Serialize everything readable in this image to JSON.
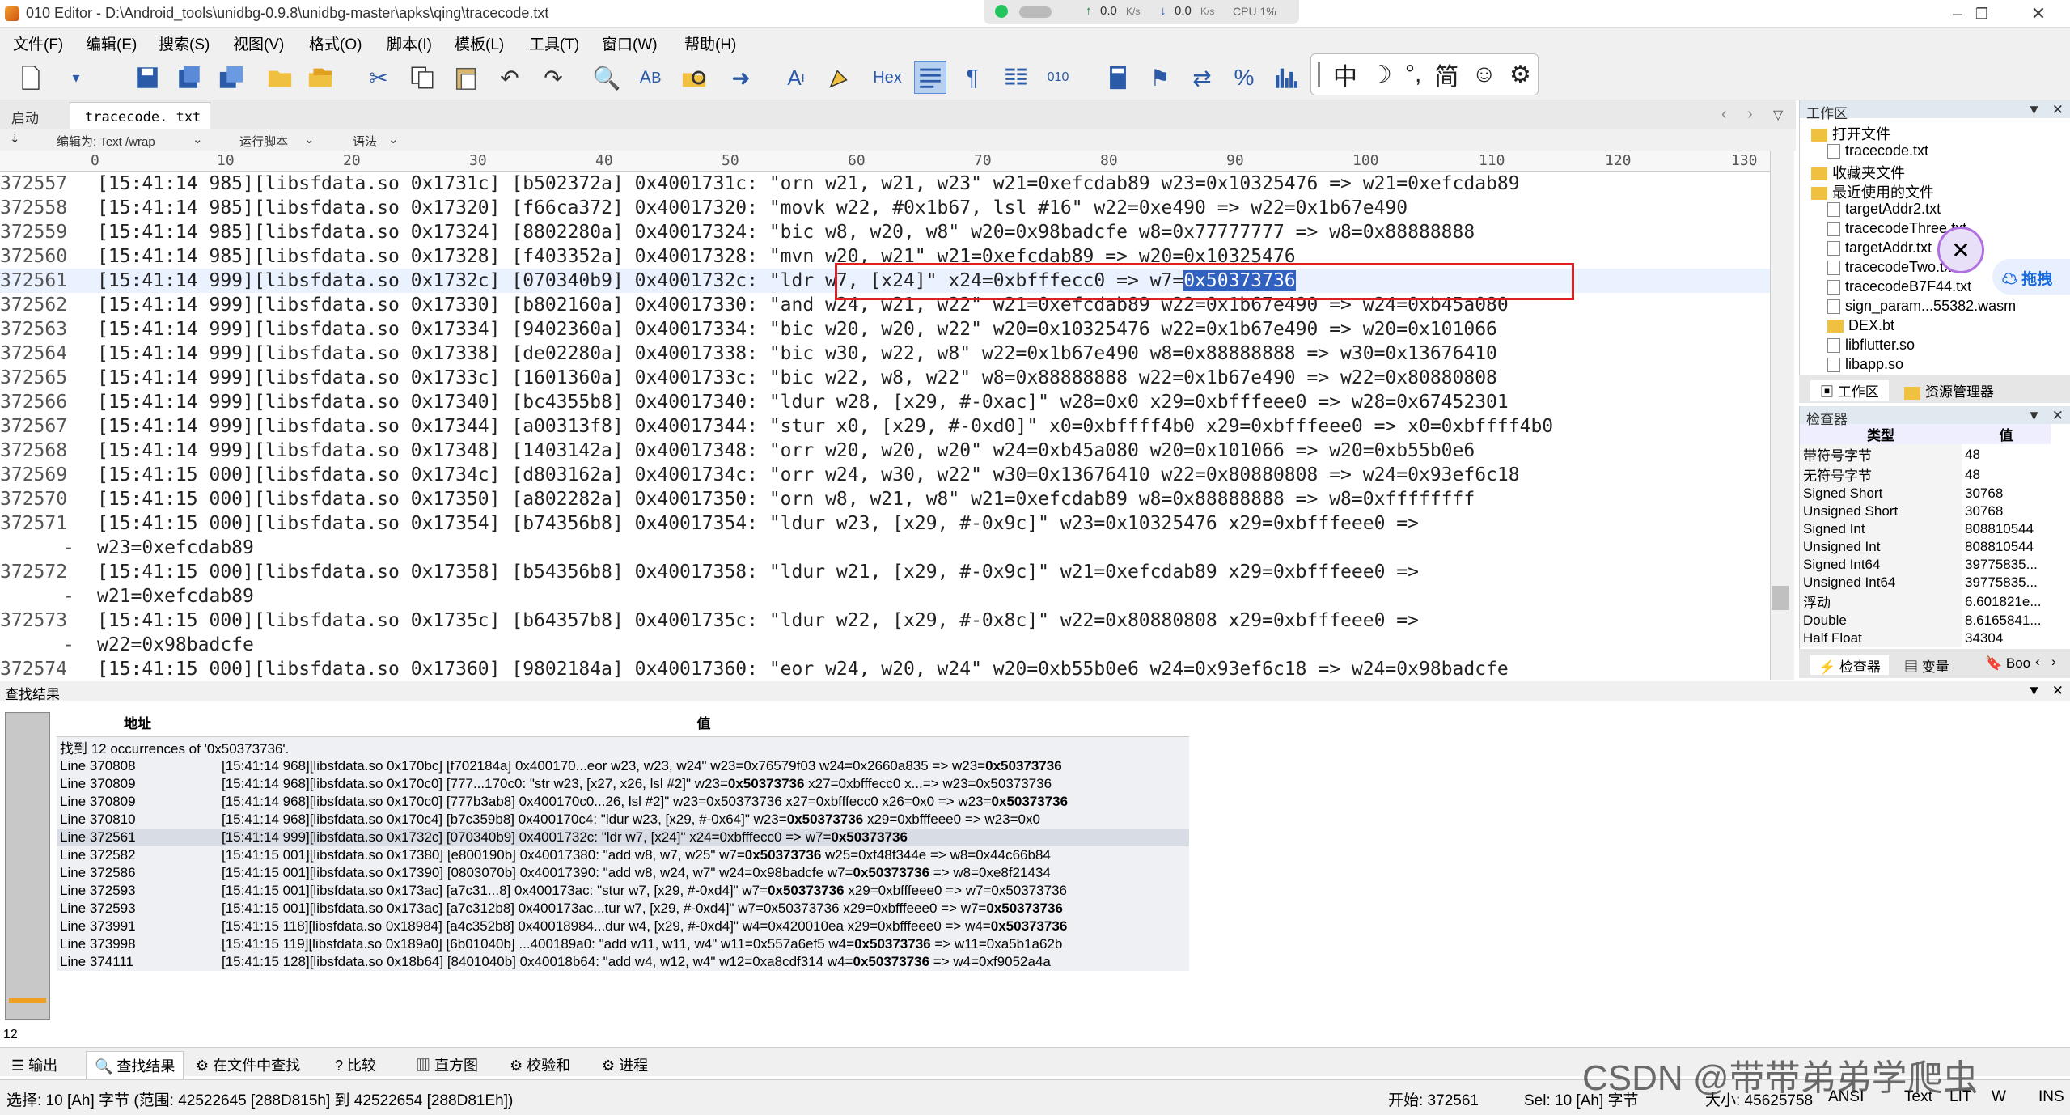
{
  "window": {
    "title": "010 Editor - D:\\Android_tools\\unidbg-0.9.8\\unidbg-master\\apks\\qing\\tracecode.txt",
    "net_up": "0.0",
    "net_down": "0.0",
    "net_unit": "K/s",
    "cpu": "CPU 1%"
  },
  "menu": [
    "文件(F)",
    "编辑(E)",
    "搜索(S)",
    "视图(V)",
    "格式(O)",
    "脚本(I)",
    "模板(L)",
    "工具(T)",
    "窗口(W)",
    "帮助(H)"
  ],
  "toolbar": {
    "hex_label": "Hex",
    "ime": [
      "中",
      "☽",
      "°,",
      "简",
      "☺",
      "⚙"
    ]
  },
  "tabs": {
    "start": "启动",
    "active": "tracecode. txt"
  },
  "editor_opts": {
    "encoding": "编辑为: Text /wrap",
    "run_script": "运行脚本",
    "syntax": "语法"
  },
  "ruler": [
    "0",
    "10",
    "20",
    "30",
    "40",
    "50",
    "60",
    "70",
    "80",
    "90",
    "100",
    "110",
    "120",
    "130"
  ],
  "editor_lines": [
    {
      "n": "372557",
      "t": "[15:41:14 985][libsfdata.so 0x1731c] [b502372a] 0x4001731c: \"orn w21, w21, w23\" w21=0xefcdab89 w23=0x10325476 => w21=0xefcdab89"
    },
    {
      "n": "372558",
      "t": "[15:41:14 985][libsfdata.so 0x17320] [f66ca372] 0x40017320: \"movk w22, #0x1b67, lsl #16\" w22=0xe490 => w22=0x1b67e490"
    },
    {
      "n": "372559",
      "t": "[15:41:14 985][libsfdata.so 0x17324] [8802280a] 0x40017324: \"bic w8, w20, w8\" w20=0x98badcfe w8=0x77777777 => w8=0x88888888"
    },
    {
      "n": "372560",
      "t": "[15:41:14 985][libsfdata.so 0x17328] [f403352a] 0x40017328: \"mvn w20, w21\" w21=0xefcdab89 => w20=0x10325476"
    },
    {
      "n": "372561",
      "t": "[15:41:14 999][libsfdata.so 0x1732c] [070340b9] 0x4001732c: \"ldr w7, [x24]\" x24=0xbfffecc0 => w7=",
      "sel": "0x50373736"
    },
    {
      "n": "372562",
      "t": "[15:41:14 999][libsfdata.so 0x17330] [b802160a] 0x40017330: \"and w24, w21, w22\" w21=0xefcdab89 w22=0x1b67e490 => w24=0xb45a080"
    },
    {
      "n": "372563",
      "t": "[15:41:14 999][libsfdata.so 0x17334] [9402360a] 0x40017334: \"bic w20, w20, w22\" w20=0x10325476 w22=0x1b67e490 => w20=0x101066"
    },
    {
      "n": "372564",
      "t": "[15:41:14 999][libsfdata.so 0x17338] [de02280a] 0x40017338: \"bic w30, w22, w8\" w22=0x1b67e490 w8=0x88888888 => w30=0x13676410"
    },
    {
      "n": "372565",
      "t": "[15:41:14 999][libsfdata.so 0x1733c] [1601360a] 0x4001733c: \"bic w22, w8, w22\" w8=0x88888888 w22=0x1b67e490 => w22=0x80880808"
    },
    {
      "n": "372566",
      "t": "[15:41:14 999][libsfdata.so 0x17340] [bc4355b8] 0x40017340: \"ldur w28, [x29, #-0xac]\" w28=0x0 x29=0xbfffeee0 => w28=0x67452301"
    },
    {
      "n": "372567",
      "t": "[15:41:14 999][libsfdata.so 0x17344] [a00313f8] 0x40017344: \"stur x0, [x29, #-0xd0]\" x0=0xbffff4b0 x29=0xbfffeee0 => x0=0xbffff4b0"
    },
    {
      "n": "372568",
      "t": "[15:41:14 999][libsfdata.so 0x17348] [1403142a] 0x40017348: \"orr w20, w20, w20\" w24=0xb45a080 w20=0x101066 => w20=0xb55b0e6"
    },
    {
      "n": "372569",
      "t": "[15:41:15 000][libsfdata.so 0x1734c] [d803162a] 0x4001734c: \"orr w24, w30, w22\" w30=0x13676410 w22=0x80880808 => w24=0x93ef6c18"
    },
    {
      "n": "372570",
      "t": "[15:41:15 000][libsfdata.so 0x17350] [a802282a] 0x40017350: \"orn w8, w21, w8\" w21=0xefcdab89 w8=0x88888888 => w8=0xffffffff"
    },
    {
      "n": "372571",
      "t": "[15:41:15 000][libsfdata.so 0x17354] [b74356b8] 0x40017354: \"ldur w23, [x29, #-0x9c]\" w23=0x10325476 x29=0xbfffeee0 =>",
      "c": "w23=0xefcdab89"
    },
    {
      "n": "372572",
      "t": "[15:41:15 000][libsfdata.so 0x17358] [b54356b8] 0x40017358: \"ldur w21, [x29, #-0x9c]\" w21=0xefcdab89 x29=0xbfffeee0 =>",
      "c": "w21=0xefcdab89"
    },
    {
      "n": "372573",
      "t": "[15:41:15 000][libsfdata.so 0x1735c] [b64357b8] 0x4001735c: \"ldur w22, [x29, #-0x8c]\" w22=0x80880808 x29=0xbfffeee0 =>",
      "c": "w22=0x98badcfe"
    },
    {
      "n": "372574",
      "t": "[15:41:15 000][libsfdata.so 0x17360] [9802184a] 0x40017360: \"eor w24, w20, w24\" w20=0xb55b0e6 w24=0x93ef6c18 => w24=0x98badcfe"
    }
  ],
  "workspace": {
    "title": "工作区",
    "open_files_label": "打开文件",
    "open_files": [
      "tracecode.txt"
    ],
    "favorites_label": "收藏夹文件",
    "recent_label": "最近使用的文件",
    "recent_files": [
      "targetAddr2.txt",
      "tracecodeThree.txt",
      "targetAddr.txt",
      "tracecodeTwo.txt",
      "tracecodeB7F44.txt",
      "sign_param...55382.wasm",
      "DEX.bt",
      "libflutter.so",
      "libapp.so"
    ],
    "tab_workspace": "工作区",
    "tab_explorer": "资源管理器",
    "side_label": "拖拽"
  },
  "inspector": {
    "title": "检查器",
    "col_type": "类型",
    "col_value": "值",
    "rows": [
      [
        "带符号字节",
        "48"
      ],
      [
        "无符号字节",
        "48"
      ],
      [
        "Signed Short",
        "30768"
      ],
      [
        "Unsigned Short",
        "30768"
      ],
      [
        "Signed Int",
        "808810544"
      ],
      [
        "Unsigned Int",
        "808810544"
      ],
      [
        "Signed Int64",
        "39775835..."
      ],
      [
        "Unsigned Int64",
        "39775835..."
      ],
      [
        "浮动",
        "6.601821e..."
      ],
      [
        "Double",
        "8.6165841..."
      ],
      [
        "Half Float",
        "34304"
      ]
    ],
    "tab_inspector": "检查器",
    "tab_vars": "变量",
    "tab_book": "Boo"
  },
  "results": {
    "title": "查找结果",
    "col_addr": "地址",
    "col_value": "值",
    "summary": "找到 12 occurrences of '0x50373736'.",
    "rows": [
      {
        "a": "Line 370808",
        "v": "[15:41:14 968][libsfdata.so 0x170bc] [f702184a] 0x400170...eor w23, w23, w24\" w23=0x76579f03 w24=0x2660a835 => w23=",
        "b": "0x50373736",
        "r": ""
      },
      {
        "a": "Line 370809",
        "v": "[15:41:14 968][libsfdata.so 0x170c0] [777...170c0: \"str w23, [x27, x26, lsl #2]\" w23=",
        "b": "0x50373736",
        "r": " x27=0xbfffecc0 x...=> w23=0x50373736"
      },
      {
        "a": "Line 370809",
        "v": "[15:41:14 968][libsfdata.so 0x170c0] [777b3ab8] 0x400170c0...26, lsl #2]\" w23=0x50373736 x27=0xbfffecc0 x26=0x0 => w23=",
        "b": "0x50373736",
        "r": ""
      },
      {
        "a": "Line 370810",
        "v": "[15:41:14 968][libsfdata.so 0x170c4] [b7c359b8] 0x400170c4: \"ldur w23, [x29, #-0x64]\" w23=",
        "b": "0x50373736",
        "r": " x29=0xbfffeee0 => w23=0x0"
      },
      {
        "a": "Line 372561",
        "v": "[15:41:14 999][libsfdata.so 0x1732c] [070340b9] 0x4001732c: \"ldr w7, [x24]\" x24=0xbfffecc0 => w7=",
        "b": "0x50373736",
        "r": "",
        "sel": true
      },
      {
        "a": "Line 372582",
        "v": "[15:41:15 001][libsfdata.so 0x17380] [e800190b] 0x40017380: \"add w8, w7, w25\" w7=",
        "b": "0x50373736",
        "r": " w25=0xf48f344e => w8=0x44c66b84"
      },
      {
        "a": "Line 372586",
        "v": "[15:41:15 001][libsfdata.so 0x17390] [0803070b] 0x40017390: \"add w8, w24, w7\" w24=0x98badcfe w7=",
        "b": "0x50373736",
        "r": " => w8=0xe8f21434"
      },
      {
        "a": "Line 372593",
        "v": "[15:41:15 001][libsfdata.so 0x173ac] [a7c31...8] 0x400173ac: \"stur w7, [x29, #-0xd4]\" w7=",
        "b": "0x50373736",
        "r": " x29=0xbfffeee0 => w7=0x50373736"
      },
      {
        "a": "Line 372593",
        "v": "[15:41:15 001][libsfdata.so 0x173ac] [a7c312b8] 0x400173ac...tur w7, [x29, #-0xd4]\" w7=0x50373736 x29=0xbfffeee0 => w7=",
        "b": "0x50373736",
        "r": ""
      },
      {
        "a": "Line 373991",
        "v": "[15:41:15 118][libsfdata.so 0x18984] [a4c352b8] 0x40018984...dur w4, [x29, #-0xd4]\" w4=0x420010ea x29=0xbfffeee0 => w4=",
        "b": "0x50373736",
        "r": ""
      },
      {
        "a": "Line 373998",
        "v": "[15:41:15 119][libsfdata.so 0x189a0] [6b01040b] ...400189a0: \"add w11, w11, w4\" w11=0x557a6ef5 w4=",
        "b": "0x50373736",
        "r": " => w11=0xa5b1a62b"
      },
      {
        "a": "Line 374111",
        "v": "[15:41:15 128][libsfdata.so 0x18b64] [8401040b] 0x40018b64: \"add w4, w12, w4\" w12=0xa8cdf314 w4=",
        "b": "0x50373736",
        "r": " => w4=0xf9052a4a"
      }
    ],
    "count_label": "12"
  },
  "bottom_tabs": [
    "输出",
    "查找结果",
    "在文件中查找",
    "比较",
    "直方图",
    "校验和",
    "进程"
  ],
  "status": {
    "selection": "选择: 10 [Ah] 字节 (范围: 42522645 [288D815h] 到 42522654 [288D81Eh])",
    "start": "开始: 372561",
    "sel": "Sel: 10 [Ah] 字节",
    "size": "大小: 45625758",
    "encoding": "ANSI",
    "mode": "Text",
    "lit": "LIT",
    "w": "W",
    "ins": "INS"
  },
  "watermark": "CSDN @带带弟弟学爬虫"
}
